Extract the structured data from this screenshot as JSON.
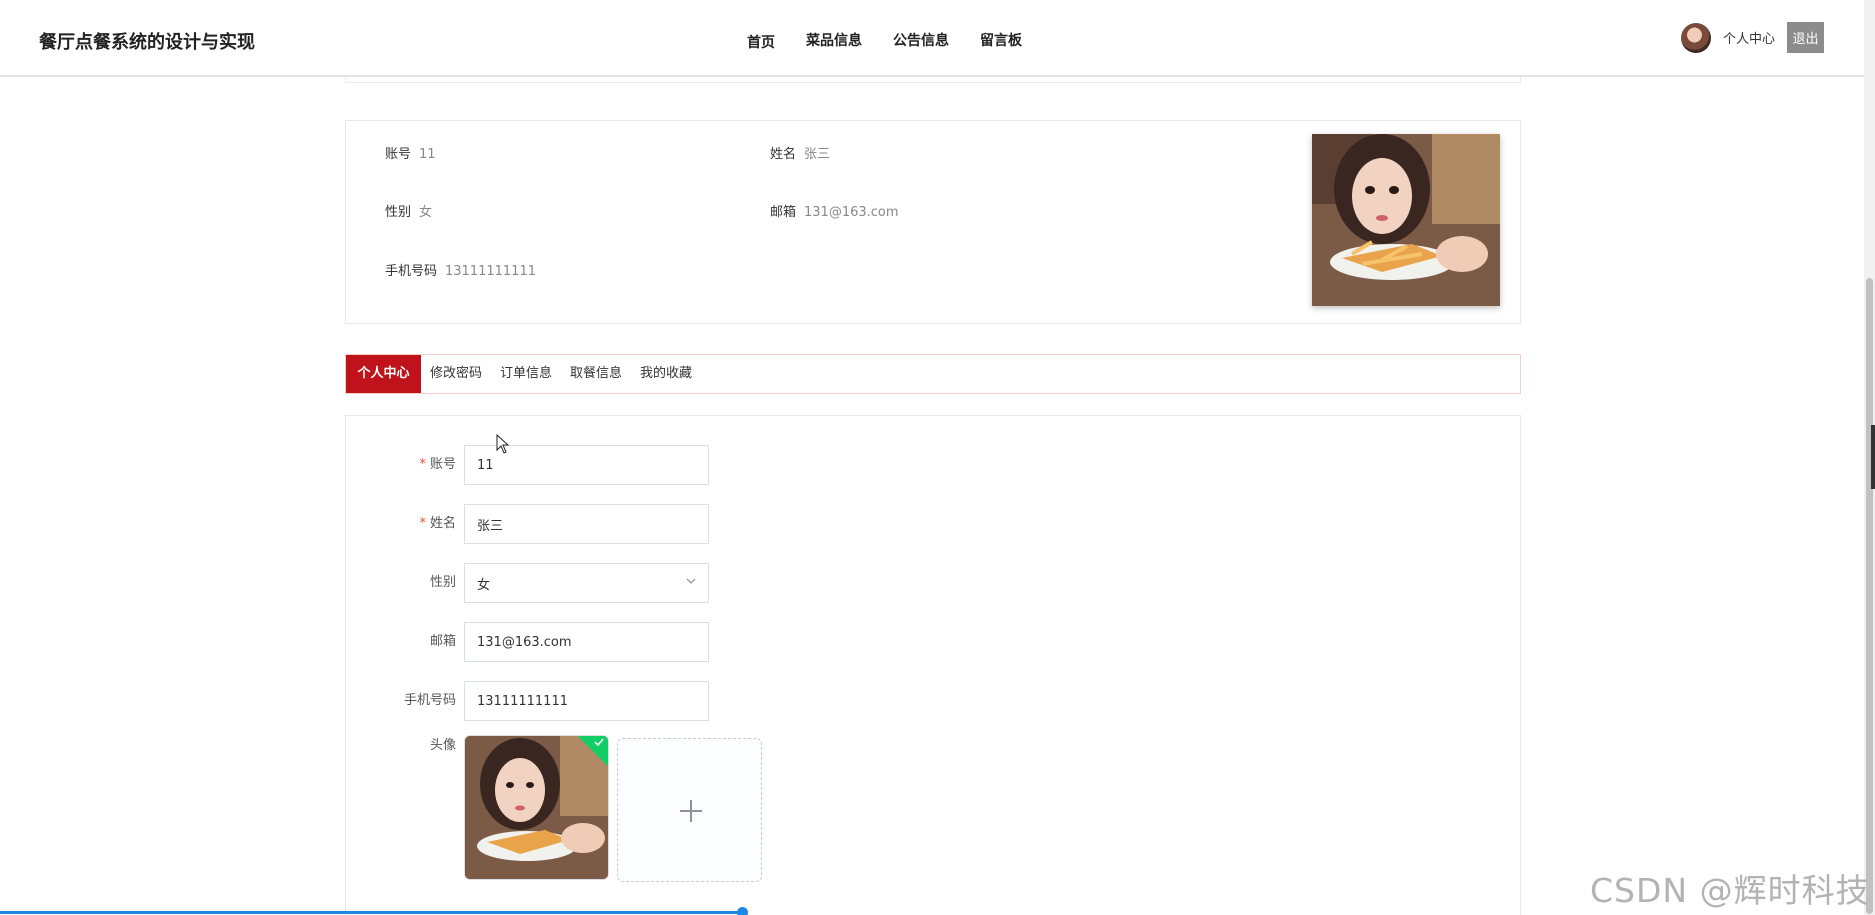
{
  "header": {
    "site_title": "餐厅点餐系统的设计与实现",
    "nav": [
      "首页",
      "菜品信息",
      "公告信息",
      "留言板"
    ],
    "user_center": "个人中心",
    "logout": "退出"
  },
  "profile": {
    "account_label": "账号",
    "account_value": "11",
    "name_label": "姓名",
    "name_value": "张三",
    "gender_label": "性别",
    "gender_value": "女",
    "email_label": "邮箱",
    "email_value": "131@163.com",
    "phone_label": "手机号码",
    "phone_value": "13111111111"
  },
  "tabs": [
    "个人中心",
    "修改密码",
    "订单信息",
    "取餐信息",
    "我的收藏"
  ],
  "active_tab": "个人中心",
  "form": {
    "account": {
      "label": "账号",
      "value": "11",
      "required": true
    },
    "name": {
      "label": "姓名",
      "value": "张三",
      "required": true
    },
    "gender": {
      "label": "性别",
      "value": "女"
    },
    "email": {
      "label": "邮箱",
      "value": "131@163.com"
    },
    "phone": {
      "label": "手机号码",
      "value": "13111111111"
    },
    "avatar_label": "头像",
    "required_mark": "*"
  },
  "upload_status_icon": "check-icon",
  "add_icon": "plus-icon",
  "watermark": "CSDN @辉时科技",
  "colors": {
    "accent": "#c0121a",
    "success": "#13ce66",
    "progress": "#1e88e5"
  }
}
